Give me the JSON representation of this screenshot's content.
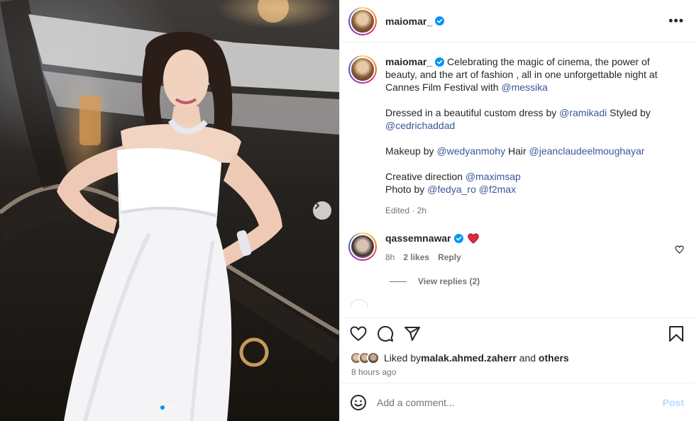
{
  "post": {
    "author": "maiomar_",
    "more_label": "•••",
    "next_label": "›",
    "slides": {
      "count": 3,
      "active": 1
    }
  },
  "caption": {
    "username": "maiomar_",
    "line1": " Celebrating the magic of cinema, the power of beauty, and the art of fashion , all in one unforgettable night at Cannes Film Festival with ",
    "m_messika": "@messika",
    "line2": "Dressed in a beautiful custom dress by ",
    "m_ramikadi": "@ramikadi",
    "styled_by": " Styled by ",
    "m_cedric": "@cedrichaddad",
    "makeup_by": "Makeup by ",
    "m_wedyan": "@wedyanmohy",
    "hair": " Hair ",
    "m_jean": "@jeanclaudeelmoughayar",
    "creative": "Creative direction ",
    "m_maxim": "@maximsap",
    "photo_by": "Photo by ",
    "m_fedya": "@fedya_ro",
    "space": " ",
    "m_f2max": "@f2max",
    "edited": "Edited · 2h"
  },
  "comment": {
    "username": "qassemnawar",
    "time": "8h",
    "likes": "2 likes",
    "reply": "Reply",
    "view_replies": "View replies (2)"
  },
  "likes": {
    "prefix": "Liked by ",
    "user": "malak.ahmed.zaherr",
    "and": " and ",
    "others": "others",
    "time_ago": "8 hours ago"
  },
  "composer": {
    "placeholder": "Add a comment...",
    "post_label": "Post"
  },
  "colors": {
    "accent": "#0095f6",
    "mention": "#385898",
    "heart": "#ed4956"
  },
  "icons": [
    "verified-icon",
    "more-icon",
    "heart-icon",
    "comment-icon",
    "share-icon",
    "save-icon",
    "emoji-icon",
    "chevron-right-icon"
  ]
}
